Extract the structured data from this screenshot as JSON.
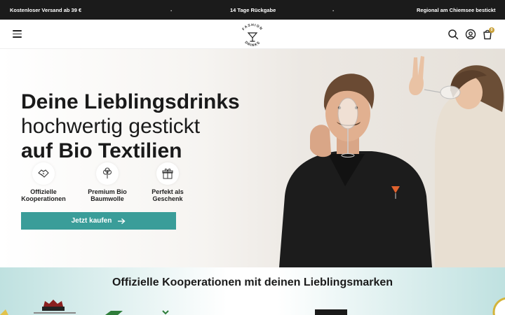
{
  "announcement": {
    "msg1": "Kostenloser Versand ab 39 €",
    "msg2": "14 Tage Rückgabe",
    "msg3": "Regional am Chiemsee bestickt",
    "separator": "."
  },
  "header": {
    "logo_text_top": "FASHION",
    "logo_text_bottom": "DRINKS",
    "cart_count": "0",
    "icons": [
      "menu-icon",
      "search-icon",
      "account-icon",
      "cart-icon"
    ]
  },
  "hero": {
    "headline_line1": "Deine Lieblingsdrinks",
    "headline_line2": "hochwertig gestickt",
    "headline_line3": "auf Bio Textilien",
    "features": [
      {
        "icon": "handshake-icon",
        "line1": "Offizielle",
        "line2": "Kooperationen"
      },
      {
        "icon": "cotton-icon",
        "line1": "Premium Bio",
        "line2": "Baumwolle"
      },
      {
        "icon": "gift-icon",
        "line1": "Perfekt als",
        "line2": "Geschenk"
      }
    ],
    "cta_label": "Jetzt kaufen"
  },
  "partners": {
    "title": "Offizielle Kooperationen mit deinen Lieblingsmarken"
  },
  "colors": {
    "topbar": "#1b1b1b",
    "accent": "#3a9d99",
    "badge": "#c9a13a",
    "partners_bg": "#bfe1e0"
  }
}
